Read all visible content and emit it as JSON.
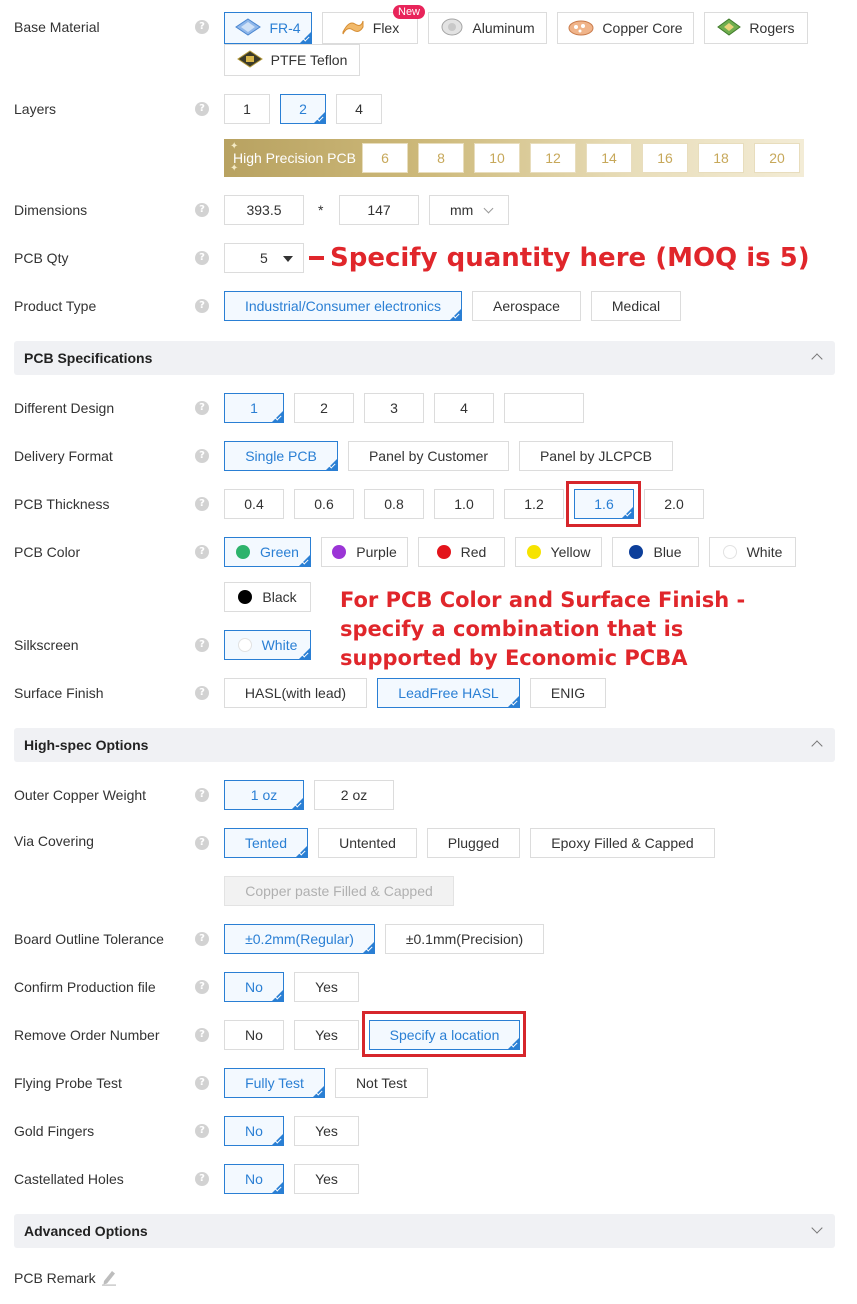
{
  "base_material": {
    "label": "Base Material",
    "options": [
      "FR-4",
      "Flex",
      "Aluminum",
      "Copper Core",
      "Rogers",
      "PTFE Teflon"
    ],
    "new_badge": "New"
  },
  "layers": {
    "label": "Layers",
    "options": [
      "1",
      "2",
      "4"
    ],
    "high_precision_label": "High Precision PCB",
    "high_precision_options": [
      "6",
      "8",
      "10",
      "12",
      "14",
      "16",
      "18",
      "20"
    ]
  },
  "dimensions": {
    "label": "Dimensions",
    "width": "393.5",
    "times": "*",
    "height": "147",
    "unit": "mm"
  },
  "pcb_qty": {
    "label": "PCB Qty",
    "value": "5",
    "note": "Specify quantity here (MOQ is 5)"
  },
  "product_type": {
    "label": "Product Type",
    "options": [
      "Industrial/Consumer electronics",
      "Aerospace",
      "Medical"
    ]
  },
  "pcb_specs": {
    "title": "PCB Specifications",
    "different_design": {
      "label": "Different Design",
      "options": [
        "1",
        "2",
        "3",
        "4"
      ],
      "custom_value": ""
    },
    "delivery_format": {
      "label": "Delivery Format",
      "options": [
        "Single PCB",
        "Panel by Customer",
        "Panel by JLCPCB"
      ]
    },
    "thickness": {
      "label": "PCB Thickness",
      "options": [
        "0.4",
        "0.6",
        "0.8",
        "1.0",
        "1.2",
        "1.6",
        "2.0"
      ]
    },
    "color": {
      "label": "PCB Color",
      "options": [
        "Green",
        "Purple",
        "Red",
        "Yellow",
        "Blue",
        "White",
        "Black"
      ],
      "colors": [
        "#2db36c",
        "#9b35d6",
        "#e3141b",
        "#f6e300",
        "#0d3f9a",
        "#ffffff",
        "#000000"
      ]
    },
    "color_note": [
      "For PCB Color and Surface Finish -",
      "specify a combination that is",
      "supported by Economic PCBA"
    ],
    "silkscreen": {
      "label": "Silkscreen",
      "value": "White"
    },
    "surface_finish": {
      "label": "Surface Finish",
      "options": [
        "HASL(with lead)",
        "LeadFree HASL",
        "ENIG"
      ]
    }
  },
  "high_spec": {
    "title": "High-spec Options",
    "outer_copper": {
      "label": "Outer Copper Weight",
      "options": [
        "1 oz",
        "2 oz"
      ]
    },
    "via_covering": {
      "label": "Via Covering",
      "options": [
        "Tented",
        "Untented",
        "Plugged",
        "Epoxy Filled & Capped",
        "Copper paste Filled & Capped"
      ]
    },
    "outline_tolerance": {
      "label": "Board Outline Tolerance",
      "options": [
        "±0.2mm(Regular)",
        "±0.1mm(Precision)"
      ]
    },
    "confirm_production": {
      "label": "Confirm Production file",
      "options": [
        "No",
        "Yes"
      ]
    },
    "remove_order_number": {
      "label": "Remove Order Number",
      "options": [
        "No",
        "Yes",
        "Specify a location"
      ]
    },
    "flying_probe": {
      "label": "Flying Probe Test",
      "options": [
        "Fully Test",
        "Not Test"
      ]
    },
    "gold_fingers": {
      "label": "Gold Fingers",
      "options": [
        "No",
        "Yes"
      ]
    },
    "castellated": {
      "label": "Castellated Holes",
      "options": [
        "No",
        "Yes"
      ]
    }
  },
  "advanced": {
    "title": "Advanced Options",
    "pcb_remark": "PCB Remark"
  },
  "help_glyph": "?"
}
